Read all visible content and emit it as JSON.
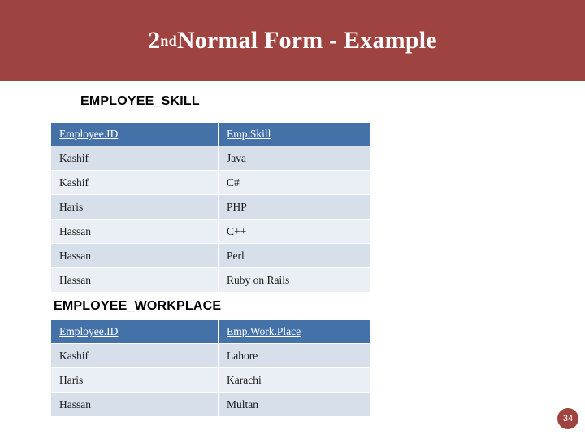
{
  "slide": {
    "title_prefix": "2",
    "title_superscript": "nd",
    "title_rest": " Normal Form - Example",
    "page_number": "34",
    "band_color": "#9e4340",
    "header_color": "#4472a8",
    "row_color_odd": "#d7dfea",
    "row_color_even": "#eaeff5"
  },
  "tables": [
    {
      "heading": "EMPLOYEE_SKILL",
      "columns": [
        "Employee.ID",
        "Emp.Skill"
      ],
      "rows": [
        [
          "Kashif",
          "Java"
        ],
        [
          "Kashif",
          "C#"
        ],
        [
          "Haris",
          "PHP"
        ],
        [
          "Hassan",
          "C++"
        ],
        [
          "Hassan",
          "Perl"
        ],
        [
          "Hassan",
          "Ruby on Rails"
        ]
      ]
    },
    {
      "heading": "EMPLOYEE_WORKPLACE",
      "columns": [
        "Employee.ID",
        "Emp.Work.Place"
      ],
      "rows": [
        [
          "Kashif",
          "Lahore"
        ],
        [
          "Haris",
          "Karachi"
        ],
        [
          "Hassan",
          "Multan"
        ]
      ]
    }
  ]
}
